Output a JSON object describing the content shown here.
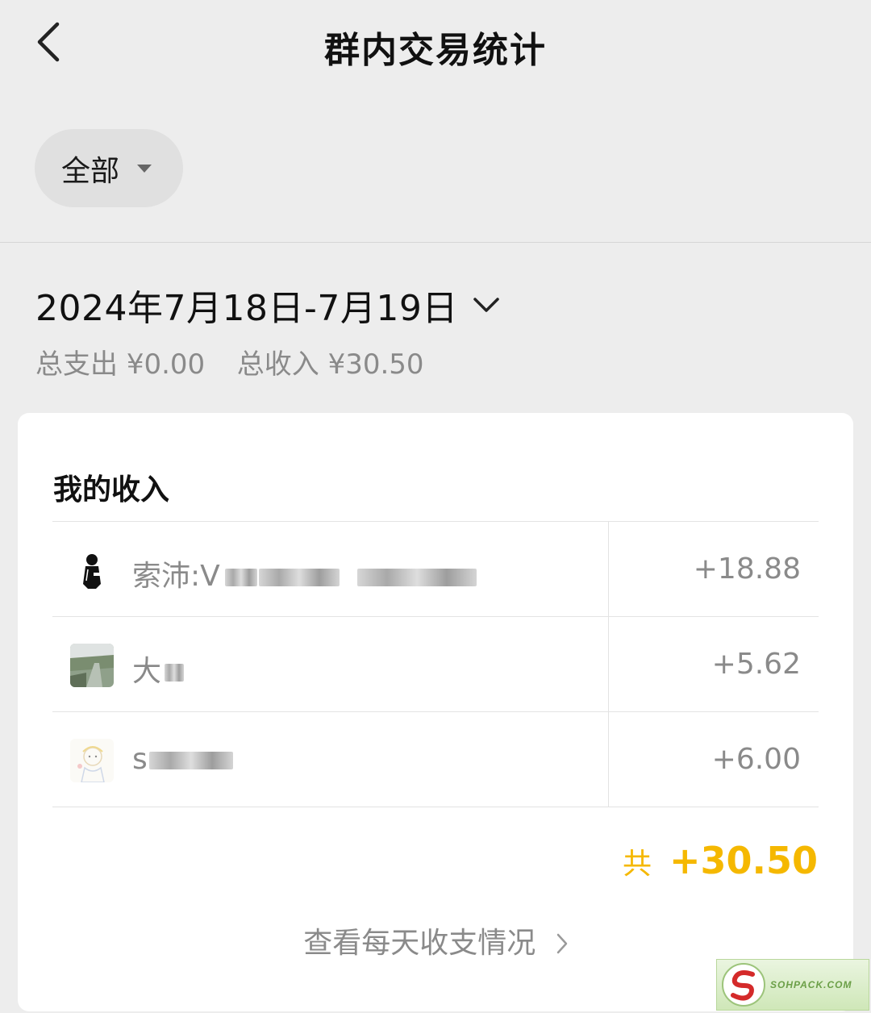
{
  "header": {
    "title": "群内交易统计"
  },
  "filter": {
    "label": "全部"
  },
  "period": {
    "date_range": "2024年7月18日-7月19日",
    "total_expense_label": "总支出",
    "total_expense": "¥0.00",
    "total_income_label": "总收入",
    "total_income": "¥30.50"
  },
  "income_card": {
    "title": "我的收入",
    "rows": [
      {
        "name_visible": "索沛:V",
        "amount": "+18.88"
      },
      {
        "name_visible": "大",
        "amount": "+5.62"
      },
      {
        "name_visible": "s",
        "amount": "+6.00"
      }
    ],
    "sum_label": "共",
    "sum_value": "+30.50",
    "daily_link": "查看每天收支情况"
  },
  "watermark": {
    "text": "SOHPACK.COM"
  },
  "colors": {
    "accent": "#f5b800",
    "background": "#ededed",
    "muted_text": "#8a8a8a"
  },
  "icons": [
    "back-arrow-icon",
    "caret-down-icon",
    "chevron-down-icon",
    "chevron-right-icon"
  ]
}
